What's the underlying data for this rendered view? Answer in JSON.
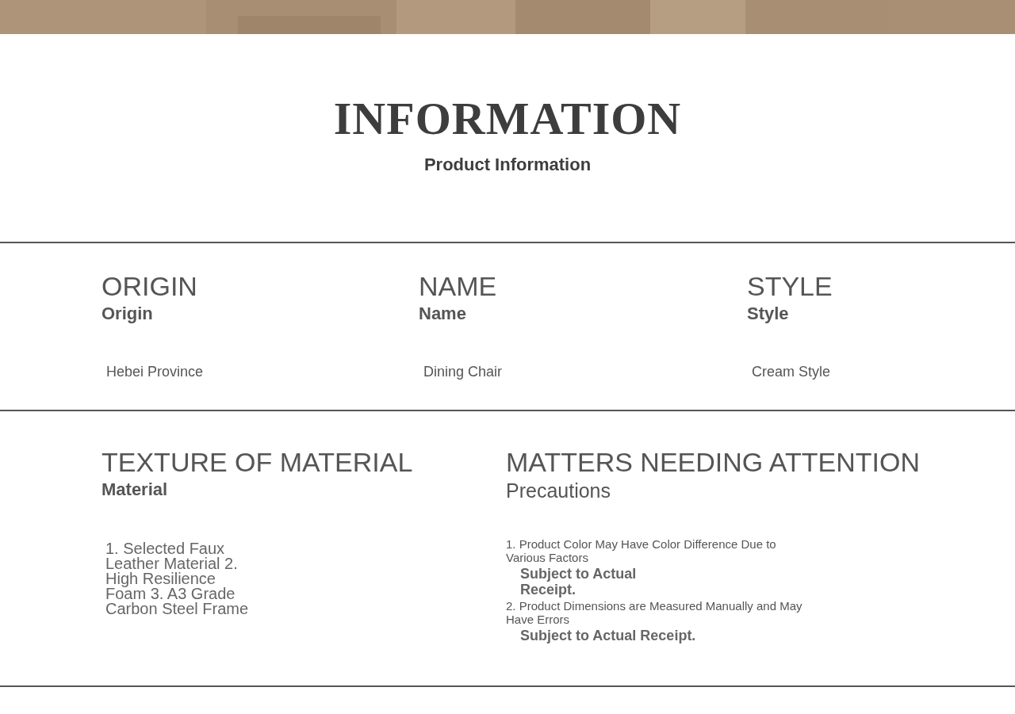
{
  "title": "INFORMATION",
  "subtitle": "Product Information",
  "attributes": [
    {
      "heading": "ORIGIN",
      "label": "Origin",
      "value": "Hebei Province"
    },
    {
      "heading": "NAME",
      "label": "Name",
      "value": "Dining Chair"
    },
    {
      "heading": "STYLE",
      "label": "Style",
      "value": "Cream Style"
    }
  ],
  "material": {
    "heading": "TEXTURE OF MATERIAL",
    "label": "Material",
    "text": "1. Selected Faux Leather Material 2. High Resilience Foam 3. A3 Grade Carbon Steel Frame"
  },
  "precautions": {
    "heading": "MATTERS NEEDING ATTENTION",
    "label": "Precautions",
    "notes": [
      {
        "kind": "note",
        "text": "1. Product Color May Have Color Difference Due to Various Factors"
      },
      {
        "kind": "remark",
        "text": "Subject to Actual Receipt."
      },
      {
        "kind": "note",
        "text": "2. Product Dimensions are Measured Manually and May Have Errors"
      },
      {
        "kind": "remark",
        "text": "Subject to Actual Receipt."
      }
    ]
  }
}
